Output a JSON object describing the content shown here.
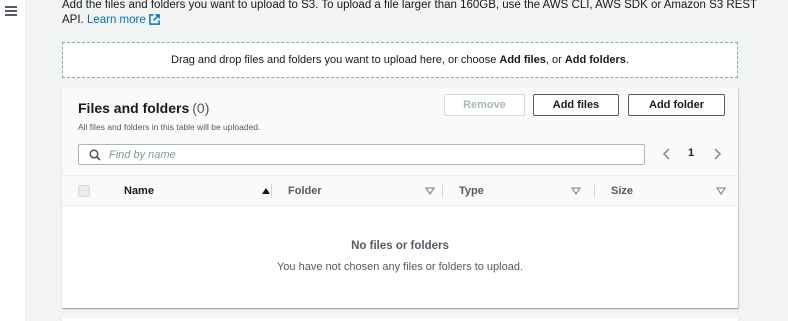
{
  "intro": {
    "text": "Add the files and folders you want to upload to S3. To upload a file larger than 160GB, use the AWS CLI, AWS SDK or Amazon S3 REST API.",
    "learn_more": "Learn more"
  },
  "dropzone": {
    "prefix": "Drag and drop files and folders you want to upload here, or choose ",
    "add_files": "Add files",
    "middle": ", or ",
    "add_folders": "Add folders",
    "suffix": "."
  },
  "panel": {
    "title": "Files and folders",
    "count": "(0)",
    "description": "All files and folders in this table will be uploaded.",
    "buttons": {
      "remove": "Remove",
      "add_files": "Add files",
      "add_folder": "Add folder"
    },
    "search": {
      "placeholder": "Find by name",
      "value": ""
    },
    "pagination": {
      "current_page": "1"
    },
    "columns": {
      "name": "Name",
      "folder": "Folder",
      "type": "Type",
      "size": "Size"
    },
    "empty": {
      "title": "No files or folders",
      "description": "You have not chosen any files or folders to upload."
    }
  },
  "colors": {
    "link": "#0073bb",
    "text": "#16191f",
    "muted": "#545b64",
    "border": "#eaeded",
    "dropzone_border": "#7fa6c4"
  },
  "icons": [
    "menu-icon",
    "external-link-icon",
    "search-icon",
    "chevron-left-icon",
    "chevron-right-icon",
    "sort-ascending-icon",
    "sort-descending-icon"
  ]
}
